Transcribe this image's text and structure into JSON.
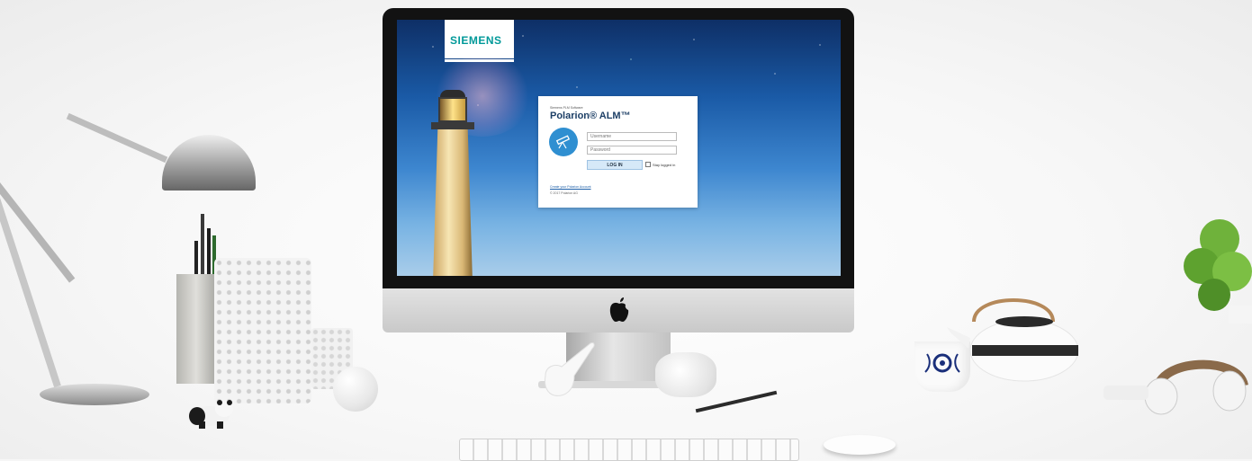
{
  "login_screen": {
    "brand": "SIEMENS",
    "vendor": "Siemens PLM Software",
    "product": "Polarion® ALM™",
    "username_placeholder": "Username",
    "password_placeholder": "Password",
    "login_button": "LOG IN",
    "stay_logged_in": "Stay logged in",
    "create_account_link": "Create your Polarion Account",
    "copyright": "© 2017 Polarion AG"
  },
  "icons": {
    "brand_badge": "telescope-icon",
    "computer_logo": "apple-icon"
  },
  "colors": {
    "siemens_teal": "#009999",
    "badge_blue": "#2f8fd1",
    "button_bg": "#d6e9f8",
    "sky_top": "#0e2f66",
    "sky_bottom": "#a9cdea"
  }
}
